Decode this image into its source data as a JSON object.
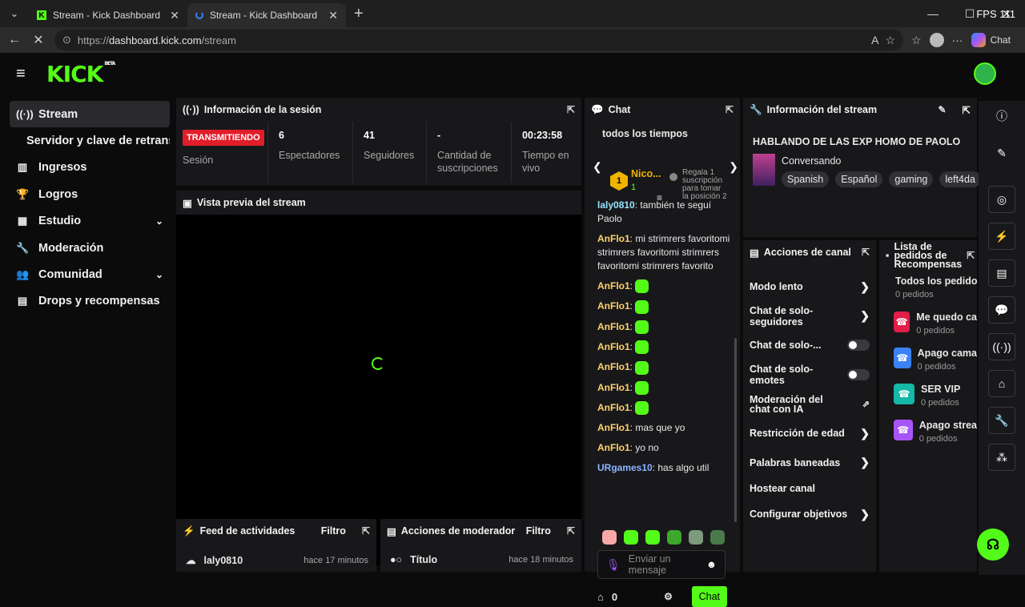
{
  "browser": {
    "tabs": [
      {
        "title": "Stream - Kick Dashboard"
      },
      {
        "title": "Stream - Kick Dashboard"
      }
    ],
    "fps": "FPS 111",
    "url_prefix": "https://",
    "url_host": "dashboard.kick.com",
    "url_path": "/stream",
    "chat_label": "Chat"
  },
  "brand": {
    "logo": "KICK",
    "beta": "BETA",
    "accent": "#53fc18"
  },
  "sidebar": {
    "items": [
      {
        "label": "Stream",
        "icon": "broadcast-icon"
      },
      {
        "label": "Servidor y clave de retransmisión"
      },
      {
        "label": "Ingresos",
        "icon": "chart-icon"
      },
      {
        "label": "Logros",
        "icon": "trophy-icon"
      },
      {
        "label": "Estudio",
        "icon": "grid-icon"
      },
      {
        "label": "Moderación",
        "icon": "wrench-icon"
      },
      {
        "label": "Comunidad",
        "icon": "community-icon"
      },
      {
        "label": "Drops y recompensas",
        "icon": "drops-icon"
      }
    ]
  },
  "session": {
    "title": "Información de la sesión",
    "status": "TRANSMITIENDO",
    "status_label": "Sesión",
    "viewers_value": "6",
    "viewers_label": "Espectadores",
    "followers_value": "41",
    "followers_label": "Seguidores",
    "subs_value": "-",
    "subs_label": "Cantidad de suscripciones",
    "uptime_value": "00:23:58",
    "uptime_label": "Tiempo en vivo"
  },
  "preview": {
    "title": "Vista previa del stream"
  },
  "feed": {
    "title": "Feed de actividades",
    "filter": "Filtro",
    "row_user": "laly0810",
    "row_time": "hace 17 minutos"
  },
  "modactions": {
    "title": "Acciones de moderador",
    "filter": "Filtro",
    "row_label": "Título",
    "row_time": "hace 18 minutos"
  },
  "chat": {
    "title": "Chat",
    "leader_header": "todos los tiempos",
    "leader_name": "Nico...",
    "leader_rank": "1",
    "leader_sub": "1",
    "leader_gift": "Regala 1 suscripción para tomar la posición 2",
    "messages": [
      {
        "user": "laly0810",
        "text": "también te seguí Paolo"
      },
      {
        "user": "AnFlo1",
        "text": "mi strimrers favoritomi strimrers favoritomi strimrers favoritomi strimrers favorito"
      },
      {
        "user": "AnFlo1",
        "text": ""
      },
      {
        "user": "AnFlo1",
        "text": ""
      },
      {
        "user": "AnFlo1",
        "text": ""
      },
      {
        "user": "AnFlo1",
        "text": ""
      },
      {
        "user": "AnFlo1",
        "text": ""
      },
      {
        "user": "AnFlo1",
        "text": ""
      },
      {
        "user": "AnFlo1",
        "text": ""
      },
      {
        "user": "AnFlo1",
        "text": "mas que yo"
      },
      {
        "user": "AnFlo1",
        "text": "yo no"
      },
      {
        "user": "URgames10",
        "text": "has algo util"
      }
    ],
    "input_placeholder": "Enviar un mensaje",
    "count": "0",
    "send_label": "Chat"
  },
  "streaminfo": {
    "title": "Información del stream",
    "stream_title": "HABLANDO DE LAS EXP HOMO DE PAOLO",
    "category": "Conversando",
    "tags": [
      "Spanish",
      "Español",
      "gaming",
      "left4da"
    ]
  },
  "actions": {
    "title": "Acciones de canal",
    "items": [
      {
        "label": "Modo lento",
        "kind": "chevron"
      },
      {
        "label": "Chat de solo-seguidores",
        "kind": "chevron"
      },
      {
        "label": "Chat de solo-...",
        "kind": "toggle"
      },
      {
        "label": "Chat de solo-emotes",
        "kind": "toggle"
      },
      {
        "label": "Moderación del chat con IA",
        "kind": "external"
      },
      {
        "label": "Restricción de edad",
        "kind": "chevron"
      },
      {
        "label": "Palabras baneadas",
        "kind": "chevron"
      },
      {
        "label": "Hostear canal",
        "kind": "none"
      },
      {
        "label": "Configurar objetivos",
        "kind": "chevron"
      }
    ]
  },
  "rewards": {
    "title": "Lista de pedidos de Recompensas",
    "items": [
      {
        "title": "Todos los pedidos",
        "sub": "0 pedidos",
        "color": ""
      },
      {
        "title": "Me quedo ca",
        "sub": "0 pedidos",
        "color": "#e11d48"
      },
      {
        "title": "Apago cama",
        "sub": "0 pedidos",
        "color": "#3b82f6"
      },
      {
        "title": "SER VIP",
        "sub": "0 pedidos",
        "color": "#14b8a6"
      },
      {
        "title": "Apago strea",
        "sub": "0 pedidos",
        "color": "#a855f7"
      }
    ]
  }
}
